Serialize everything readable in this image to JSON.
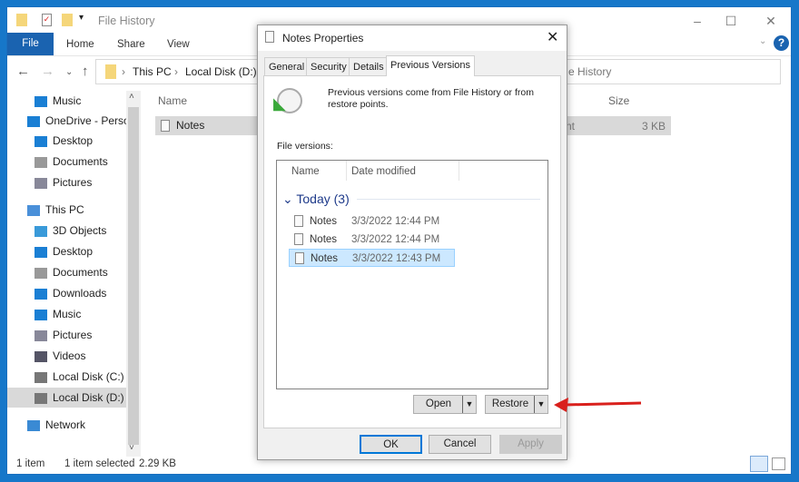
{
  "explorer": {
    "title": "File History",
    "window_controls": [
      "minimize",
      "maximize",
      "close"
    ],
    "ribbon_tabs": [
      "File",
      "Home",
      "Share",
      "View"
    ],
    "address": {
      "segments": [
        "This PC",
        "Local Disk (D:)"
      ],
      "search_partial": "e History"
    },
    "nav": [
      {
        "label": "Music",
        "icon": "music-icon"
      },
      {
        "label": "OneDrive - Persor",
        "icon": "cloud-icon"
      },
      {
        "label": "Desktop",
        "icon": "desktop-icon"
      },
      {
        "label": "Documents",
        "icon": "documents-icon"
      },
      {
        "label": "Pictures",
        "icon": "pictures-icon"
      },
      {
        "label": "This PC",
        "icon": "computer-icon"
      },
      {
        "label": "3D Objects",
        "icon": "cube-icon"
      },
      {
        "label": "Desktop",
        "icon": "desktop-icon"
      },
      {
        "label": "Documents",
        "icon": "documents-icon"
      },
      {
        "label": "Downloads",
        "icon": "download-icon"
      },
      {
        "label": "Music",
        "icon": "music-icon"
      },
      {
        "label": "Pictures",
        "icon": "pictures-icon"
      },
      {
        "label": "Videos",
        "icon": "videos-icon"
      },
      {
        "label": "Local Disk (C:)",
        "icon": "drive-icon"
      },
      {
        "label": "Local Disk (D:)",
        "icon": "drive-icon",
        "selected": true
      },
      {
        "label": "Network",
        "icon": "network-icon"
      }
    ],
    "columns": {
      "name": "Name",
      "size": "Size"
    },
    "file": {
      "name": "Notes",
      "type_partial": "nt",
      "size": "3 KB"
    },
    "status": {
      "count": "1 item",
      "selected": "1 item selected",
      "size": "2.29 KB"
    }
  },
  "dialog": {
    "title": "Notes Properties",
    "tabs": [
      "General",
      "Security",
      "Details",
      "Previous Versions"
    ],
    "active_tab": "Previous Versions",
    "info": "Previous versions come from File History or from restore points.",
    "versions_label": "File versions:",
    "list_columns": [
      "Name",
      "Date modified"
    ],
    "group": "Today (3)",
    "versions": [
      {
        "name": "Notes",
        "date": "3/3/2022 12:44 PM"
      },
      {
        "name": "Notes",
        "date": "3/3/2022 12:44 PM"
      },
      {
        "name": "Notes",
        "date": "3/3/2022 12:43 PM",
        "selected": true
      }
    ],
    "open_label": "Open",
    "restore_label": "Restore",
    "ok": "OK",
    "cancel": "Cancel",
    "apply": "Apply"
  },
  "colors": {
    "accent": "#1a63b0",
    "selection": "#cce8ff",
    "arrow": "#d9201c"
  }
}
